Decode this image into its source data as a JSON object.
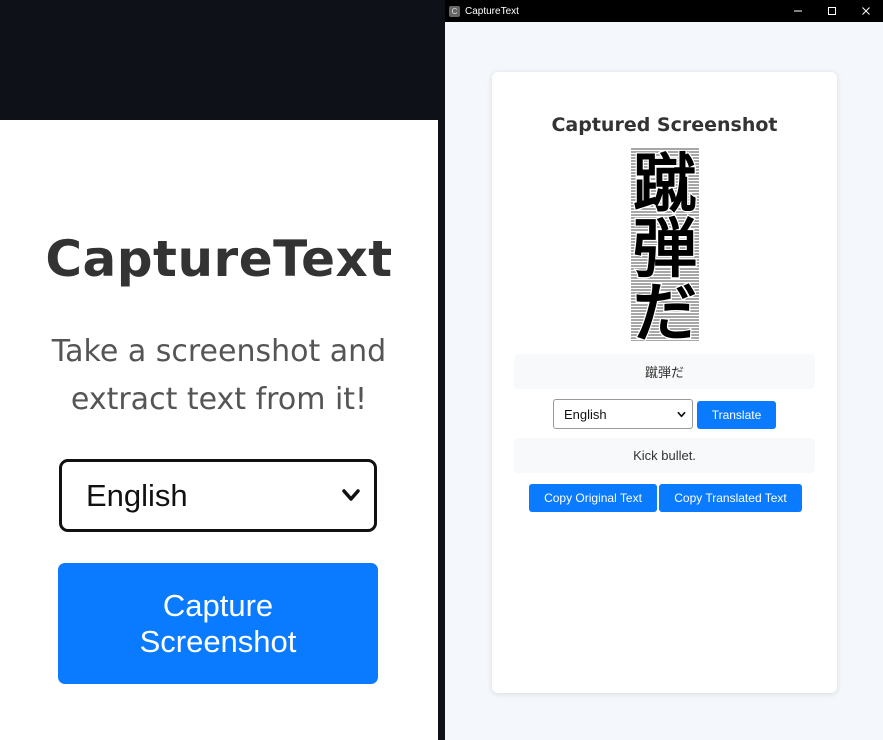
{
  "left_app": {
    "title": "CaptureText",
    "subtitle_line1": "Take a screenshot and",
    "subtitle_line2": "extract text from it!",
    "language_selected": "English",
    "capture_button_line1": "Capture",
    "capture_button_line2": "Screenshot"
  },
  "window": {
    "title": "CaptureText",
    "icon_letter": "C"
  },
  "card": {
    "title": "Captured Screenshot",
    "screenshot_text": [
      "蹴",
      "弾",
      "だ"
    ],
    "original_text": "蹴弾だ",
    "language_selected": "English",
    "translate_label": "Translate",
    "translated_text": "Kick bullet.",
    "copy_original_label": "Copy Original Text",
    "copy_translated_label": "Copy Translated Text"
  },
  "colors": {
    "accent": "#0a7bff",
    "background": "#f4f7fb",
    "dark": "#0e1218"
  }
}
